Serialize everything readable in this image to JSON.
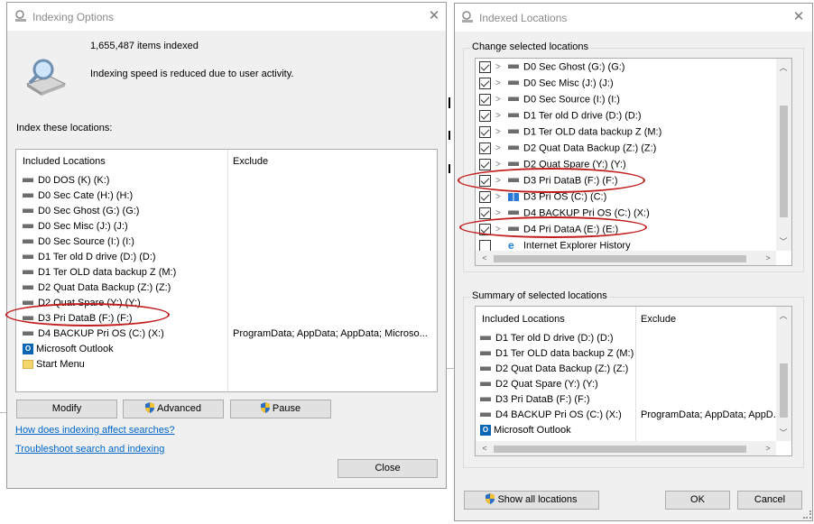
{
  "indexing_options": {
    "title": "Indexing Options",
    "items_indexed": "1,655,487 items indexed",
    "status": "Indexing speed is reduced due to user activity.",
    "section_label": "Index these locations:",
    "col_included": "Included Locations",
    "col_exclude": "Exclude",
    "locations": [
      {
        "name": "D0 DOS (K) (K:)",
        "icon": "drive-icon",
        "exclude": ""
      },
      {
        "name": "D0 Sec Cate (H:) (H:)",
        "icon": "drive-icon",
        "exclude": ""
      },
      {
        "name": "D0 Sec Ghost (G:) (G:)",
        "icon": "drive-icon",
        "exclude": ""
      },
      {
        "name": "D0 Sec Misc (J:) (J:)",
        "icon": "drive-icon",
        "exclude": ""
      },
      {
        "name": "D0 Sec Source (I:) (I:)",
        "icon": "drive-icon",
        "exclude": ""
      },
      {
        "name": "D1 Ter old D drive (D:) (D:)",
        "icon": "drive-icon",
        "exclude": ""
      },
      {
        "name": "D1 Ter OLD data backup Z (M:)",
        "icon": "drive-icon",
        "exclude": ""
      },
      {
        "name": "D2 Quat Data Backup (Z:) (Z:)",
        "icon": "drive-icon",
        "exclude": ""
      },
      {
        "name": "D2 Quat Spare  (Y:) (Y:)",
        "icon": "drive-icon",
        "exclude": ""
      },
      {
        "name": "D3 Pri DataB (F:) (F:)",
        "icon": "drive-icon",
        "exclude": ""
      },
      {
        "name": "D4 BACKUP Pri OS (C:) (X:)",
        "icon": "drive-icon",
        "exclude": "ProgramData; AppData; AppData; Microso..."
      },
      {
        "name": "Microsoft Outlook",
        "icon": "outlook-icon",
        "exclude": ""
      },
      {
        "name": "Start Menu",
        "icon": "folder-icon",
        "exclude": ""
      }
    ],
    "buttons": {
      "modify": "Modify",
      "advanced": "Advanced",
      "pause": "Pause",
      "close": "Close"
    },
    "links": {
      "how": "How does indexing affect searches?",
      "troubleshoot": "Troubleshoot search and indexing"
    }
  },
  "indexed_locations": {
    "title": "Indexed Locations",
    "change_label": "Change selected locations",
    "tree": [
      {
        "name": "D0 Sec Ghost (G:) (G:)",
        "checked": true,
        "icon": "drive-icon"
      },
      {
        "name": "D0 Sec Misc (J:) (J:)",
        "checked": true,
        "icon": "drive-icon"
      },
      {
        "name": "D0 Sec Source (I:) (I:)",
        "checked": true,
        "icon": "drive-icon"
      },
      {
        "name": "D1 Ter old D drive (D:) (D:)",
        "checked": true,
        "icon": "drive-icon"
      },
      {
        "name": "D1 Ter OLD data backup Z (M:)",
        "checked": true,
        "icon": "drive-icon"
      },
      {
        "name": "D2 Quat Data Backup (Z:) (Z:)",
        "checked": true,
        "icon": "drive-icon"
      },
      {
        "name": "D2 Quat Spare  (Y:) (Y:)",
        "checked": true,
        "icon": "drive-icon"
      },
      {
        "name": "D3 Pri DataB (F:) (F:)",
        "checked": true,
        "icon": "drive-icon"
      },
      {
        "name": "D3 Pri OS (C:) (C:)",
        "checked": true,
        "icon": "windows-drive-icon"
      },
      {
        "name": "D4 BACKUP Pri OS (C:) (X:)",
        "checked": true,
        "icon": "drive-icon"
      },
      {
        "name": "D4 Pri DataA (E:) (E:)",
        "checked": true,
        "icon": "drive-icon"
      },
      {
        "name": "Internet Explorer History",
        "checked": false,
        "icon": "ie-icon"
      }
    ],
    "summary_label": "Summary of selected locations",
    "col_included": "Included Locations",
    "col_exclude": "Exclude",
    "summary": [
      {
        "name": "D1 Ter old D drive (D:) (D:)",
        "icon": "drive-icon",
        "exclude": ""
      },
      {
        "name": "D1 Ter OLD data backup Z (M:)",
        "icon": "drive-icon",
        "exclude": ""
      },
      {
        "name": "D2 Quat Data Backup (Z:) (Z:)",
        "icon": "drive-icon",
        "exclude": ""
      },
      {
        "name": "D2 Quat Spare  (Y:) (Y:)",
        "icon": "drive-icon",
        "exclude": ""
      },
      {
        "name": "D3 Pri DataB (F:) (F:)",
        "icon": "drive-icon",
        "exclude": ""
      },
      {
        "name": "D4 BACKUP Pri OS (C:) (X:)",
        "icon": "drive-icon",
        "exclude": "ProgramData; AppData; AppD..."
      },
      {
        "name": "Microsoft Outlook",
        "icon": "outlook-icon",
        "exclude": ""
      }
    ],
    "buttons": {
      "show_all": "Show all locations",
      "ok": "OK",
      "cancel": "Cancel"
    }
  },
  "colors": {
    "annotation_red": "#c21d1d",
    "link": "#0066cc",
    "dialog_bg": "#f0f0f0"
  }
}
